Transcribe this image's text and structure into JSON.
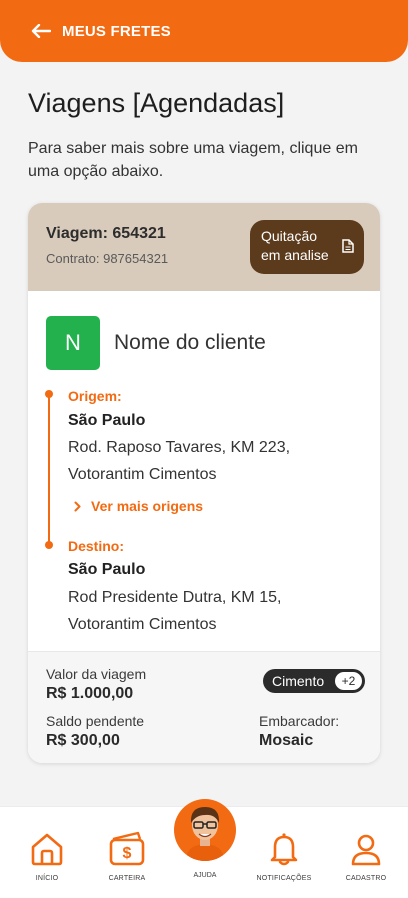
{
  "header": {
    "title": "MEUS FRETES"
  },
  "page": {
    "title": "Viagens [Agendadas]",
    "subtitle": "Para saber mais sobre uma viagem, clique em uma opção abaixo."
  },
  "trip": {
    "id_label": "Viagem: 654321",
    "contract_label": "Contrato: 987654321",
    "status_line1": "Quitação",
    "status_line2": "em analise",
    "client_initial": "N",
    "client_name": "Nome do cliente",
    "origin": {
      "label": "Origem:",
      "city": "São Paulo",
      "address_line1": "Rod. Raposo Tavares, KM 223,",
      "address_line2": "Votorantim Cimentos"
    },
    "more_origins": "Ver mais origens",
    "destination": {
      "label": "Destino:",
      "city": "São Paulo",
      "address_line1": "Rod Presidente Dutra, KM 15,",
      "address_line2": "Votorantim Cimentos"
    },
    "value_label": "Valor da viagem",
    "value": "R$ 1.000,00",
    "pending_label": "Saldo pendente",
    "pending": "R$ 300,00",
    "cargo_tag": "Cimento",
    "cargo_extra": "+2",
    "shipper_label": "Embarcador:",
    "shipper": "Mosaic"
  },
  "tabs": {
    "home": "INÍCIO",
    "wallet": "CARTEIRA",
    "help": "AJUDA",
    "notifications": "NOTIFICAÇÕES",
    "register": "CADASTRO"
  },
  "colors": {
    "accent": "#f26a12",
    "status_pill": "#5c3b1d",
    "card_header": "#d9cbbb",
    "client_avatar": "#22b14c"
  }
}
